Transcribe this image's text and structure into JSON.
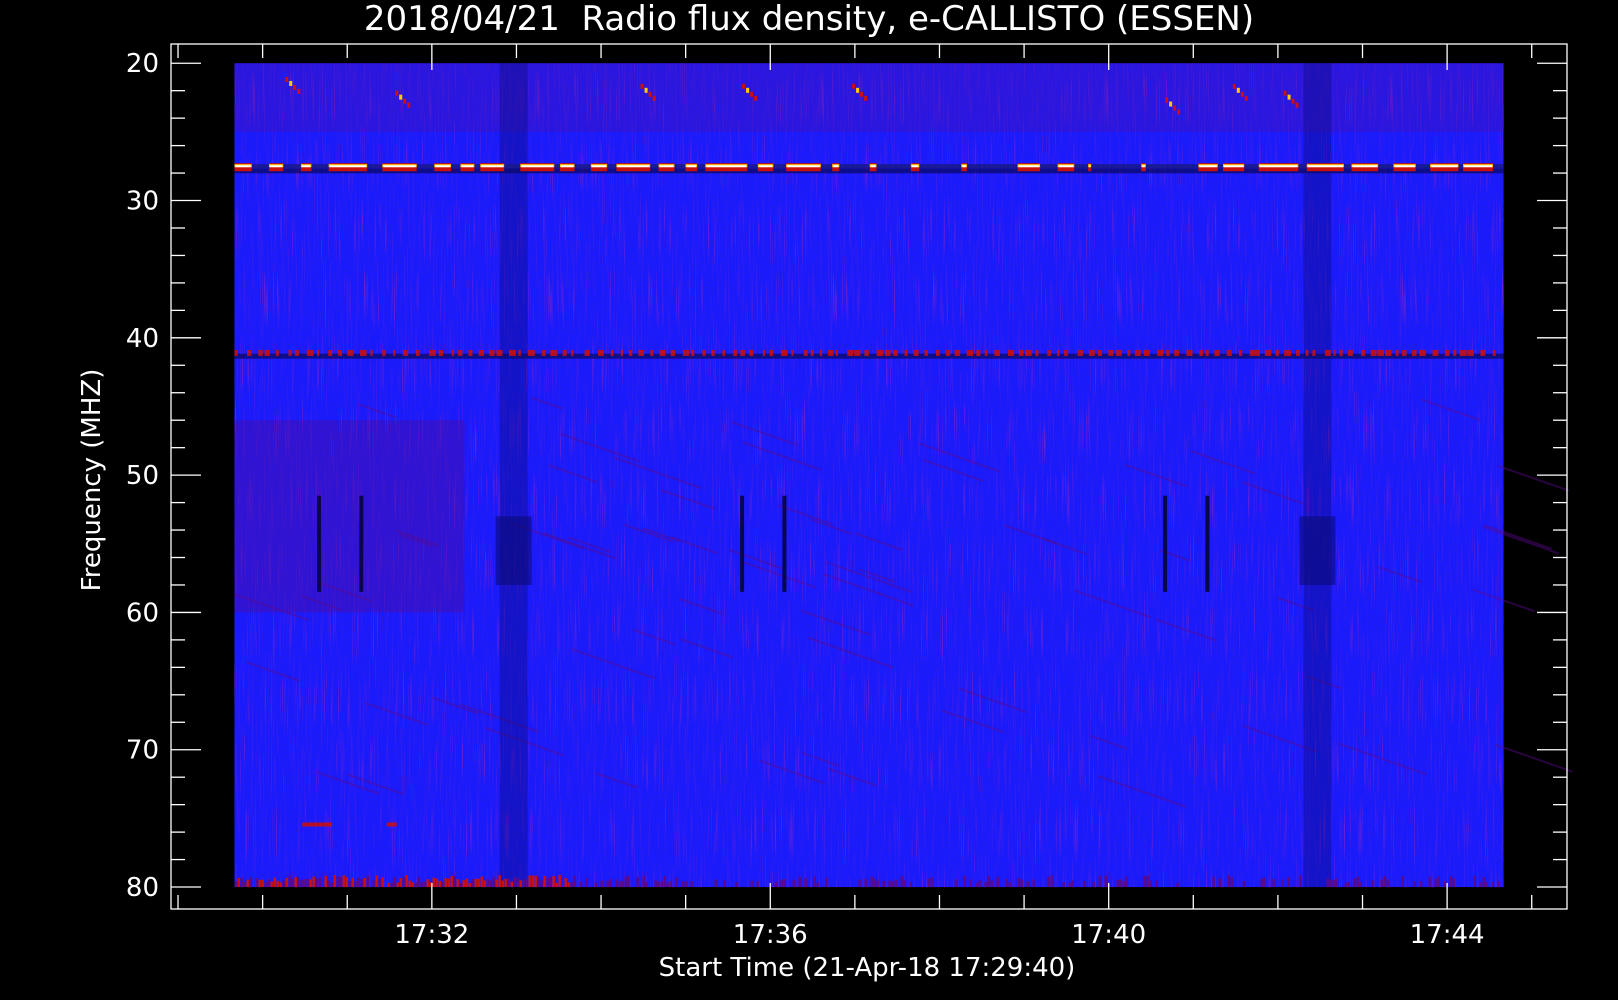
{
  "chart_data": {
    "type": "heatmap",
    "title": "2018/04/21  Radio flux density, e-CALLISTO (ESSEN)",
    "xlabel": "Start Time (21-Apr-18 17:29:40)",
    "ylabel": "Frequency (MHZ)",
    "x_unit": "minutes after 17:29:40 UT",
    "xlim": [
      -0.75,
      15.75
    ],
    "ylim": [
      18.6,
      81.6
    ],
    "y_inverted": true,
    "data_xlim": [
      0,
      15
    ],
    "data_ylim": [
      20,
      80
    ],
    "x_ticks": [
      {
        "value": 2.333,
        "label": "17:32"
      },
      {
        "value": 6.333,
        "label": "17:36"
      },
      {
        "value": 10.333,
        "label": "17:40"
      },
      {
        "value": 14.333,
        "label": "17:44"
      }
    ],
    "y_ticks": [
      {
        "value": 20,
        "label": "20"
      },
      {
        "value": 30,
        "label": "30"
      },
      {
        "value": 40,
        "label": "40"
      },
      {
        "value": 50,
        "label": "50"
      },
      {
        "value": 60,
        "label": "60"
      },
      {
        "value": 70,
        "label": "70"
      },
      {
        "value": 80,
        "label": "80"
      }
    ],
    "colormap": {
      "background": "#1a1aff",
      "dark": "#0a0a6e",
      "low": "#5a0a8a",
      "mid": "#c81010",
      "high": "#ffcc00",
      "max": "#ffffff"
    },
    "features": {
      "rfi_lines_mhz": [
        27.5,
        41.1
      ],
      "strong_rfi_mhz": 27.5,
      "dark_bands_mhz": [
        27.8,
        41.3
      ],
      "enhanced_low_edge_mhz": 79.5,
      "vertical_dark_stripes_min": [
        1.0,
        1.5,
        6.0,
        6.5,
        11.0,
        11.5
      ],
      "dark_patch_columns_min": [
        3.3,
        12.8
      ]
    }
  }
}
